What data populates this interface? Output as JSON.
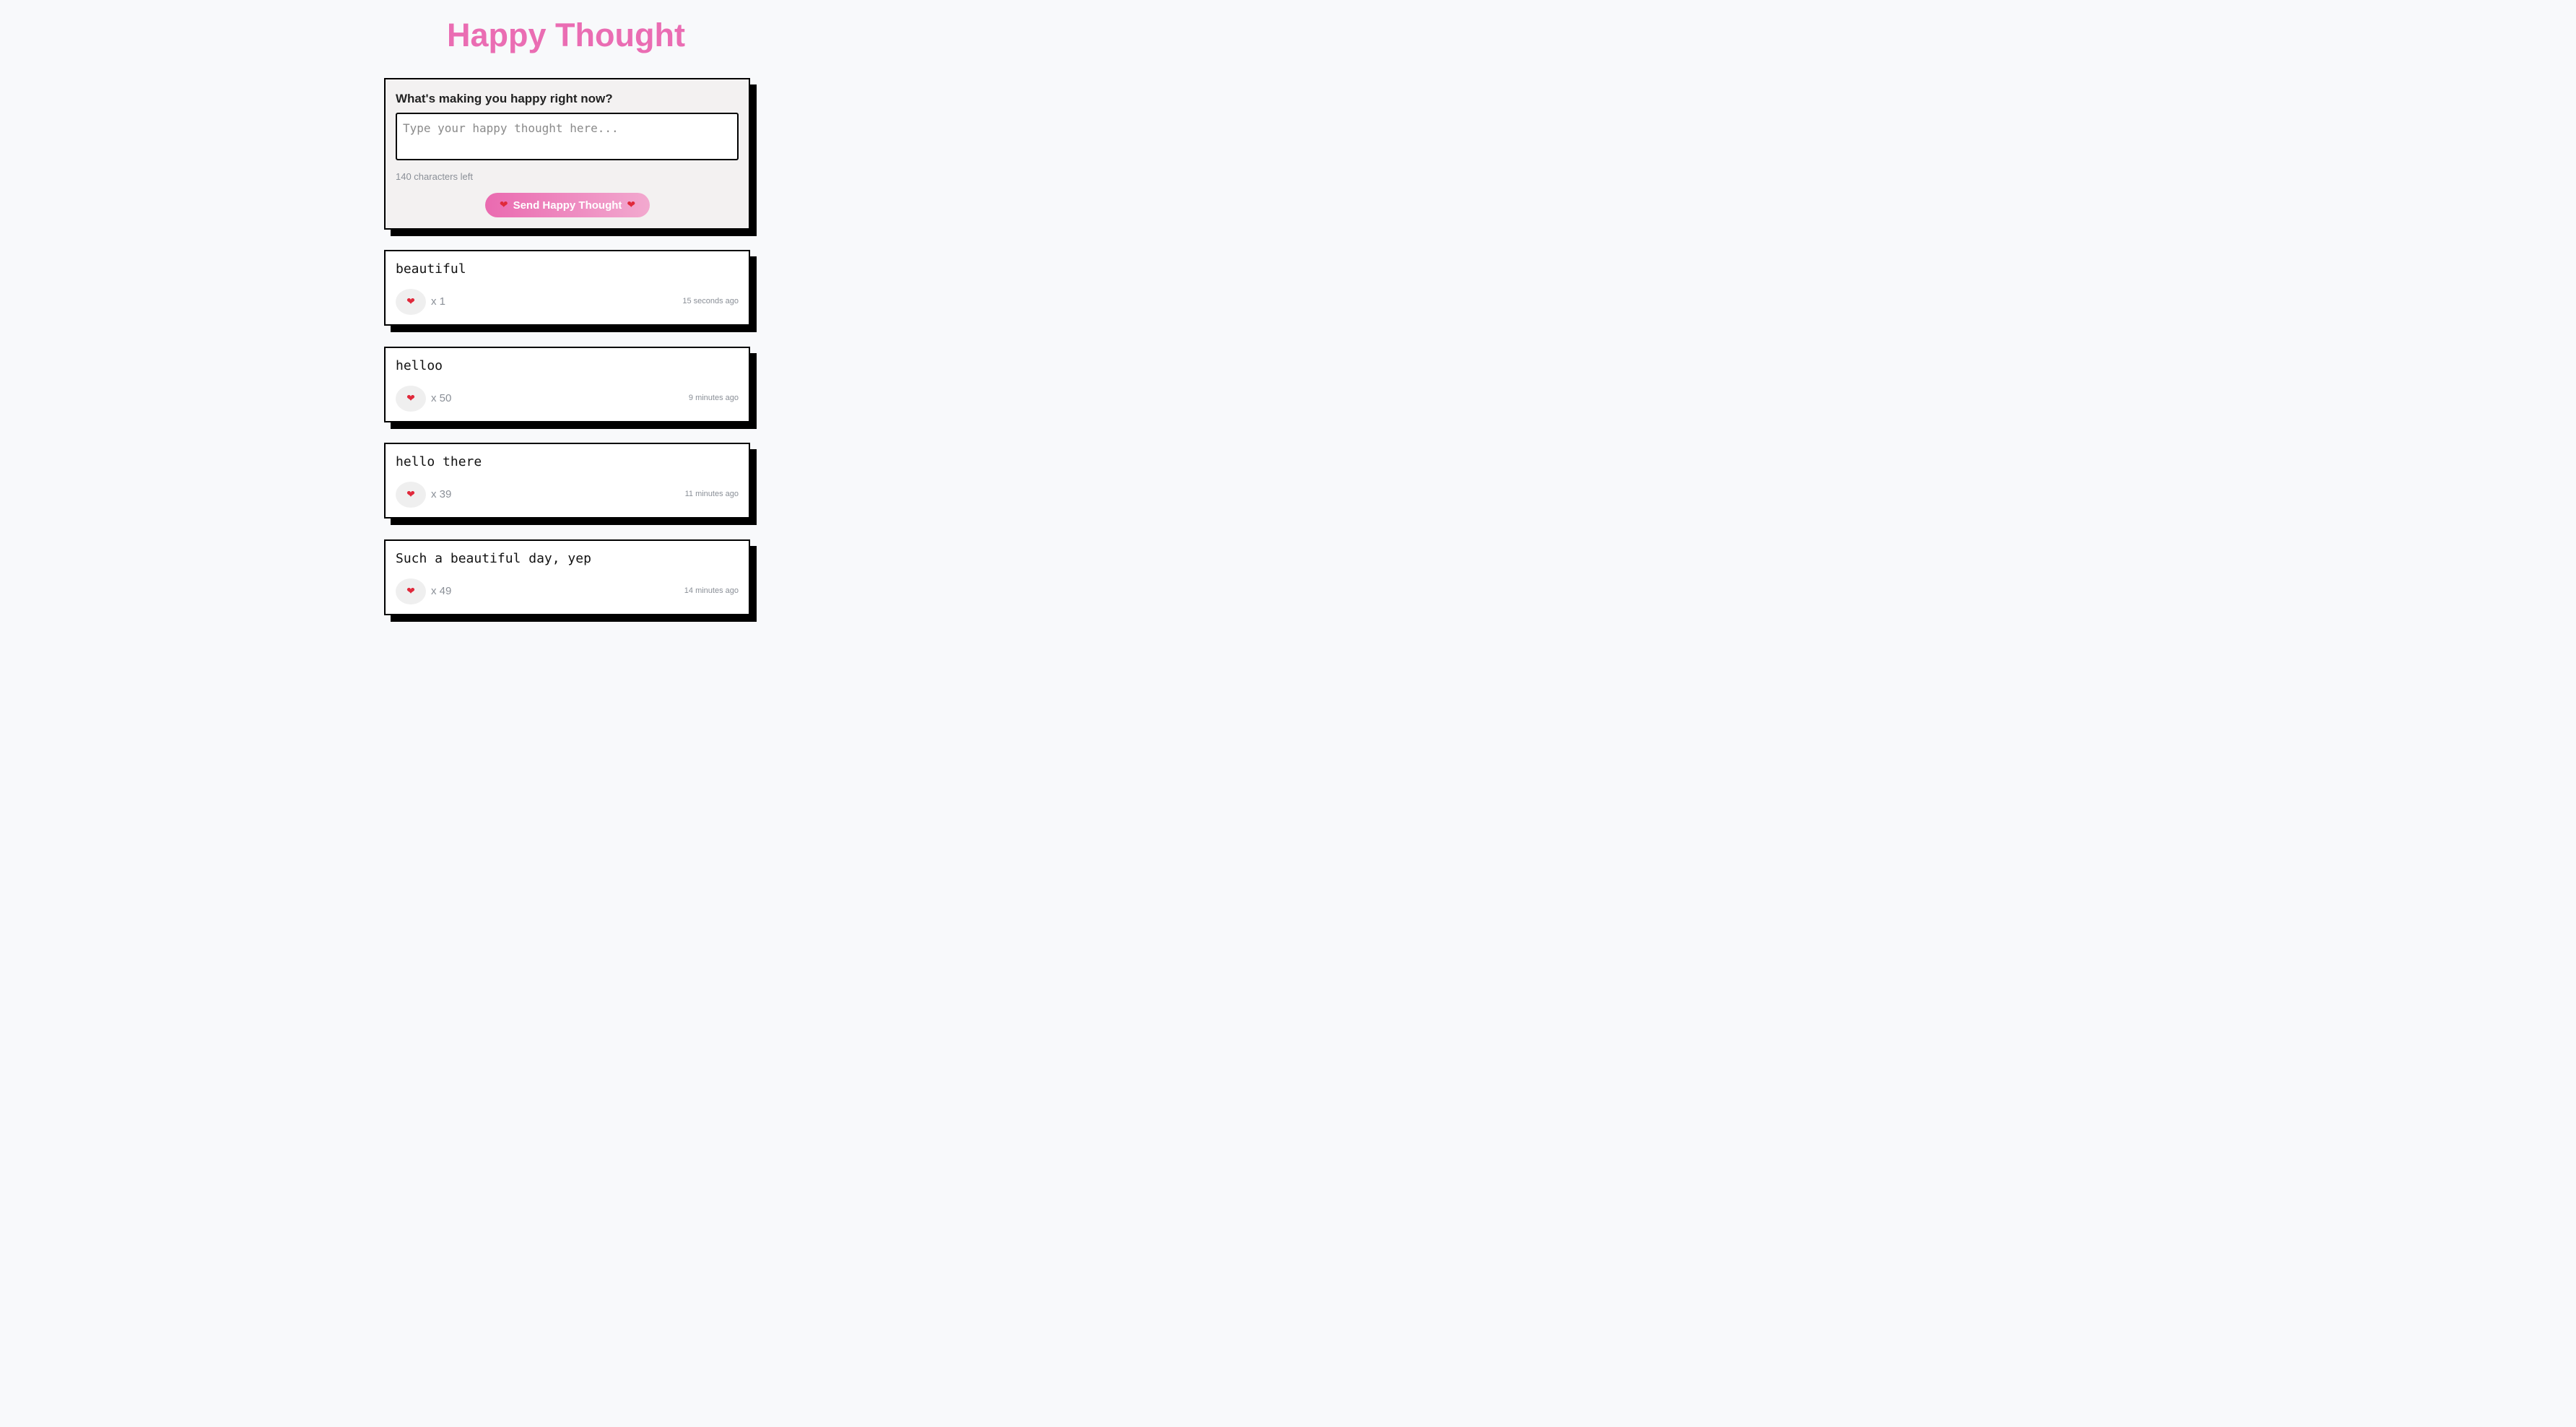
{
  "header": {
    "title": "Happy Thought"
  },
  "form": {
    "label": "What's making you happy right now?",
    "input_placeholder": "Type your happy thought here...",
    "input_value": "",
    "char_count_text": "140 characters left",
    "submit_label": "Send Happy Thought",
    "submit_icon": "heart-icon"
  },
  "colors": {
    "accent": "#ea6db3",
    "heart": "#e0293b"
  },
  "thoughts": [
    {
      "message": "beautiful",
      "likes": "x 1",
      "time": "15 seconds ago",
      "like_icon": "heart-icon"
    },
    {
      "message": "helloo",
      "likes": "x 50",
      "time": "9 minutes ago",
      "like_icon": "heart-icon"
    },
    {
      "message": "hello there",
      "likes": "x 39",
      "time": "11 minutes ago",
      "like_icon": "heart-icon"
    },
    {
      "message": "Such a beautiful day, yep",
      "likes": "x 49",
      "time": "14 minutes ago",
      "like_icon": "heart-icon"
    }
  ]
}
